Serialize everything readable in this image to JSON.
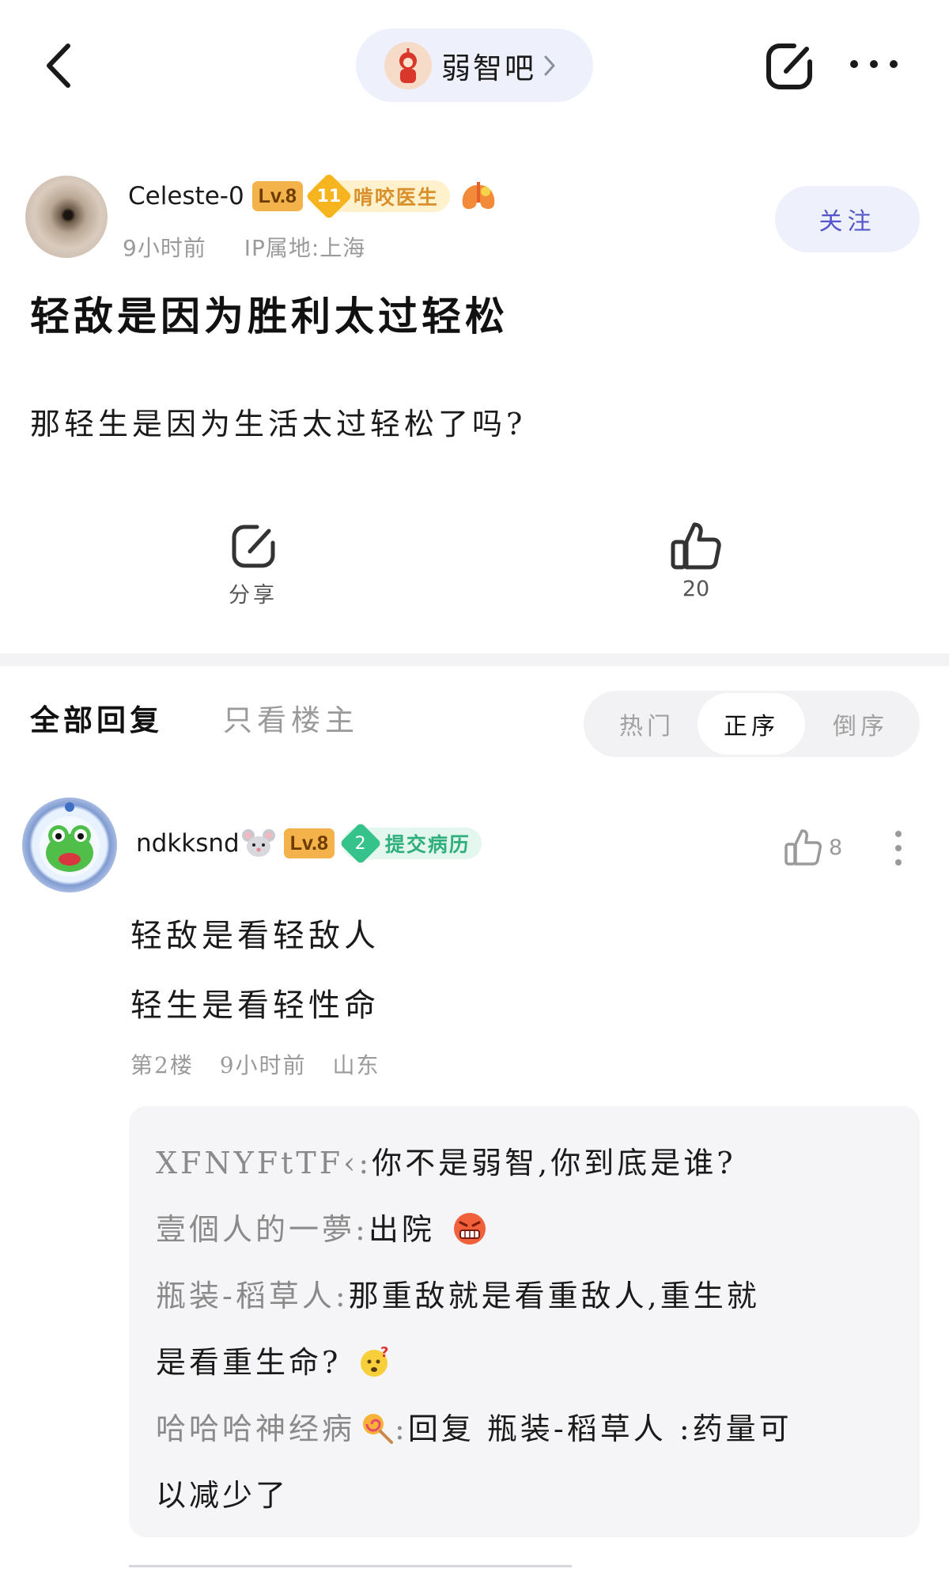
{
  "topbar": {
    "forum_name": "弱智吧"
  },
  "post": {
    "author": {
      "name": "Celeste-0",
      "level": "Lv.8",
      "honor_level": "11",
      "honor_title": "啃咬医生",
      "time": "9小时前",
      "ip": "IP属地:上海"
    },
    "follow_label": "关注",
    "title": "轻敌是因为胜利太过轻松",
    "body": "那轻生是因为生活太过轻松了吗?",
    "share_label": "分享",
    "like_count": "20"
  },
  "replies_header": {
    "tab_all": "全部回复",
    "tab_op_only": "只看楼主",
    "sort_hot": "热门",
    "sort_asc": "正序",
    "sort_desc": "倒序"
  },
  "reply": {
    "name": "ndkksnd",
    "level": "Lv.8",
    "honor_level": "2",
    "honor_title": "提交病历",
    "like_count": "8",
    "line1": "轻敌是看轻敌人",
    "line2": "轻生是看轻性命",
    "floor": "第2楼",
    "time": "9小时前",
    "location": "山东",
    "subreplies": [
      {
        "user": "XFNYFtTF‹",
        "sep": ":",
        "text": "你不是弱智,你到底是谁?"
      },
      {
        "user": "壹個人的一夢",
        "sep": ":",
        "text": "出院"
      },
      {
        "user": "瓶装-稻草人",
        "sep": ":",
        "text": "那重敌就是看重敌人,重生就"
      },
      {
        "user": "",
        "sep": "",
        "text": "是看重生命?"
      },
      {
        "user": "哈哈哈神经病",
        "sep": ":",
        "text": "回复 瓶装-稻草人 :药量可"
      },
      {
        "user": "",
        "sep": "",
        "text": "以减少了"
      }
    ]
  }
}
